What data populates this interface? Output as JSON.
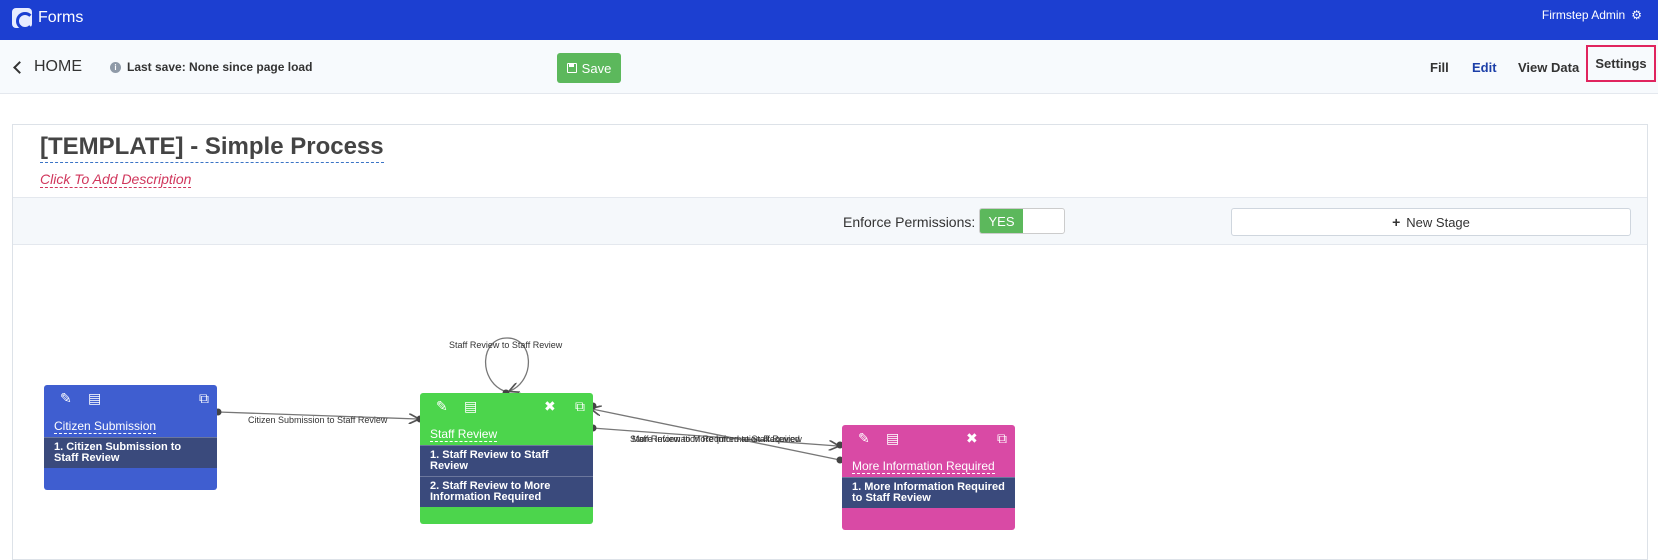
{
  "app": {
    "title": "Forms",
    "user": "Firmstep Admin"
  },
  "toolbar": {
    "home_label": "HOME",
    "last_save": "Last save: None since page load",
    "save_label": "Save",
    "nav": {
      "fill": "Fill",
      "edit": "Edit",
      "view_data": "View Data",
      "settings": "Settings"
    }
  },
  "form": {
    "title": "[TEMPLATE] - Simple Process",
    "description_placeholder": "Click To Add Description",
    "enforce_permissions_label": "Enforce Permissions:",
    "enforce_permissions_value": "YES",
    "new_stage_label": "New Stage"
  },
  "stages": [
    {
      "name": "Citizen Submission",
      "color": "#3f5ed0",
      "transitions": [
        "1. Citizen Submission to Staff Review"
      ]
    },
    {
      "name": "Staff Review",
      "color": "#4cd54c",
      "transitions": [
        "1. Staff Review to Staff Review",
        "2. Staff Review to More Information Required"
      ]
    },
    {
      "name": "More Information Required",
      "color": "#d94aa5",
      "transitions": [
        "1. More Information Required to Staff Review"
      ]
    }
  ],
  "edges": {
    "citizen_to_staff": "Citizen Submission to Staff Review",
    "staff_to_staff": "Staff Review to Staff Review",
    "staff_to_moreinfo": "Staff Review to More Information Required",
    "moreinfo_to_staff": "More Information Required to Staff Review"
  },
  "icons": [
    "gear-icon",
    "chevron-left-icon",
    "info-icon",
    "floppy-icon",
    "plus-icon",
    "pencil-icon",
    "document-icon",
    "close-icon",
    "external-link-icon"
  ]
}
